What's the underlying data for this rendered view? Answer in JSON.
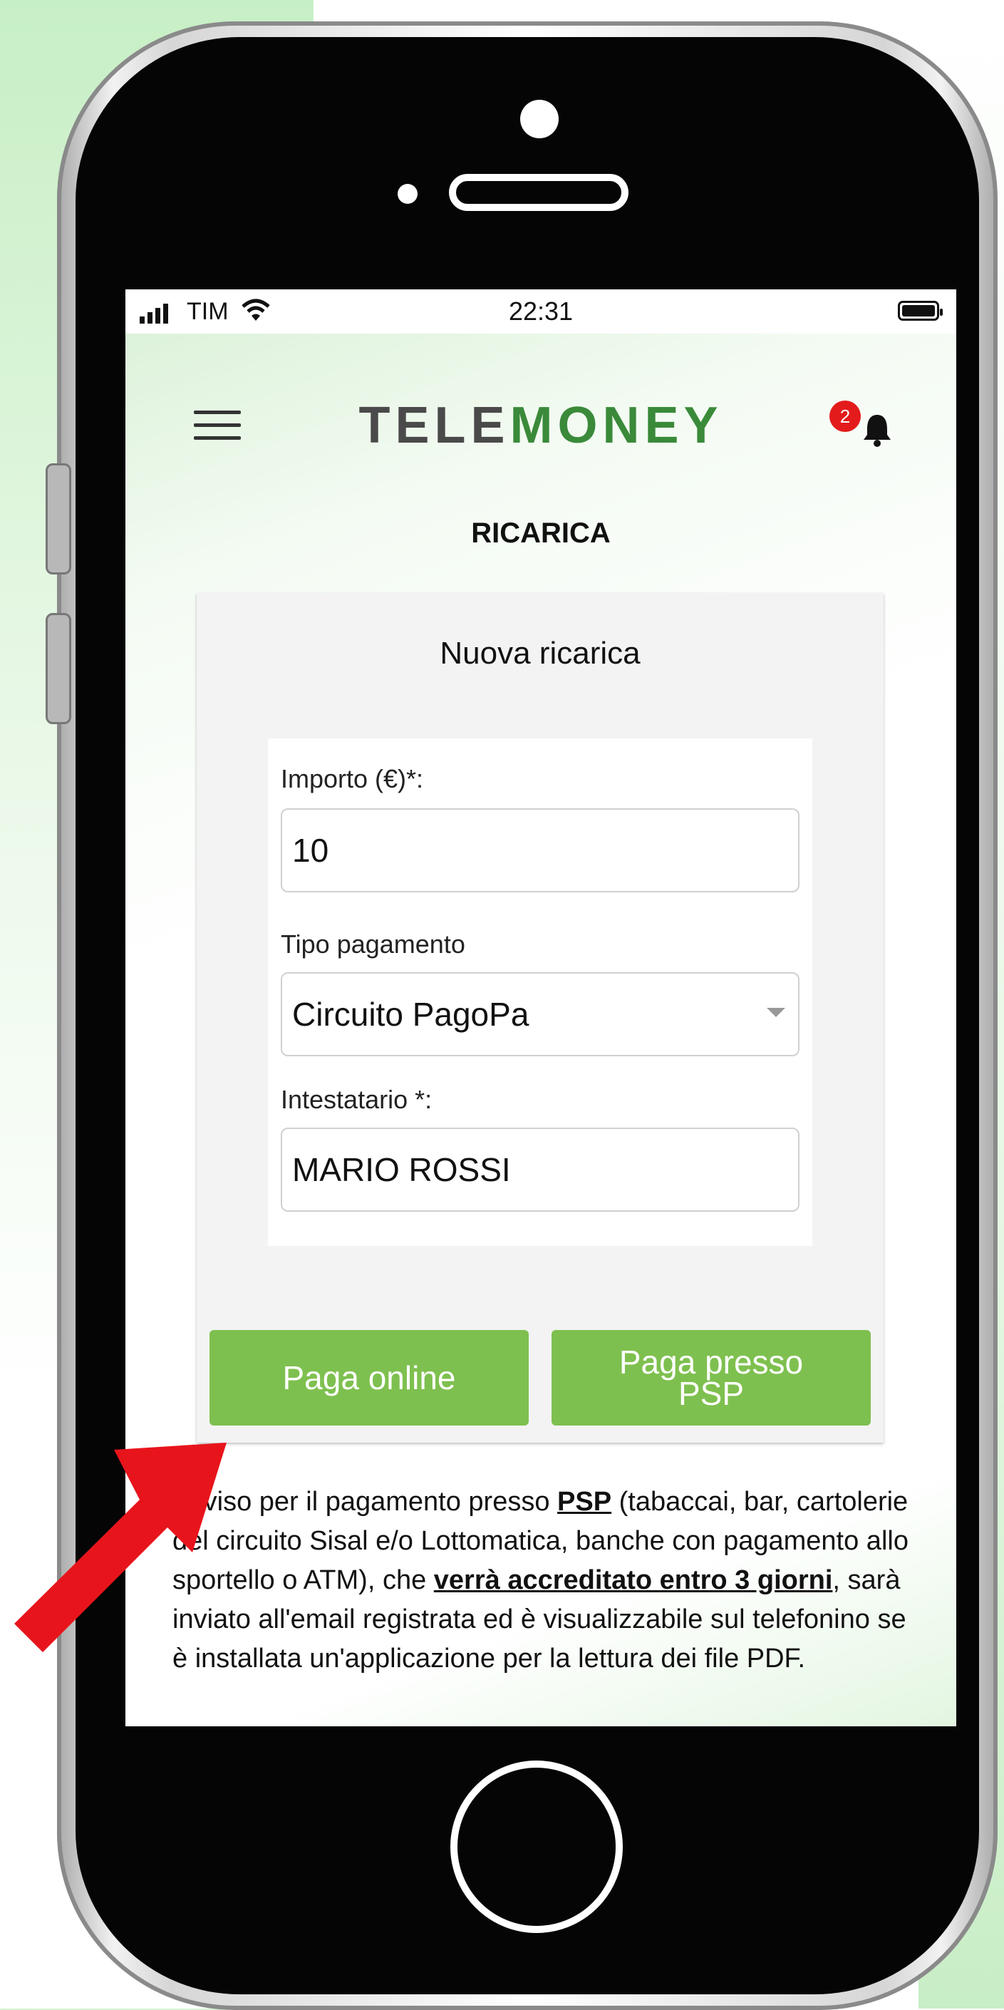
{
  "status_bar": {
    "carrier": "TIM",
    "time": "22:31"
  },
  "header": {
    "logo_part1": "TELE",
    "logo_part2": "MONEY",
    "notification_count": "2"
  },
  "page_title": "RICARICA",
  "card": {
    "title": "Nuova ricarica",
    "amount_label": "Importo (€)*:",
    "amount_value": "10",
    "payment_type_label": "Tipo pagamento",
    "payment_type_value": "Circuito PagoPa",
    "holder_label": "Intestatario *:",
    "holder_value": "MARIO  ROSSI"
  },
  "buttons": {
    "pay_online": "Paga online",
    "pay_psp_line1": "Paga presso",
    "pay_psp_line2": "PSP"
  },
  "notice": {
    "t1": "Avviso per il pagamento presso ",
    "psp": "PSP",
    "t2": " (tabaccai, bar, cartolerie del circuito Sisal e/o Lottomatica, banche con pagamento allo sportello o ATM), che ",
    "bold": "verrà accreditato entro 3 giorni",
    "t3": ", sarà inviato all'email registrata ed è visualizzabile sul telefonino se è installata un'applicazione per la lettura dei file PDF."
  },
  "colors": {
    "accent_green": "#7ec04f",
    "logo_green": "#3a8a3a",
    "badge_red": "#e31b1b",
    "annotation_arrow": "#e8141c"
  }
}
